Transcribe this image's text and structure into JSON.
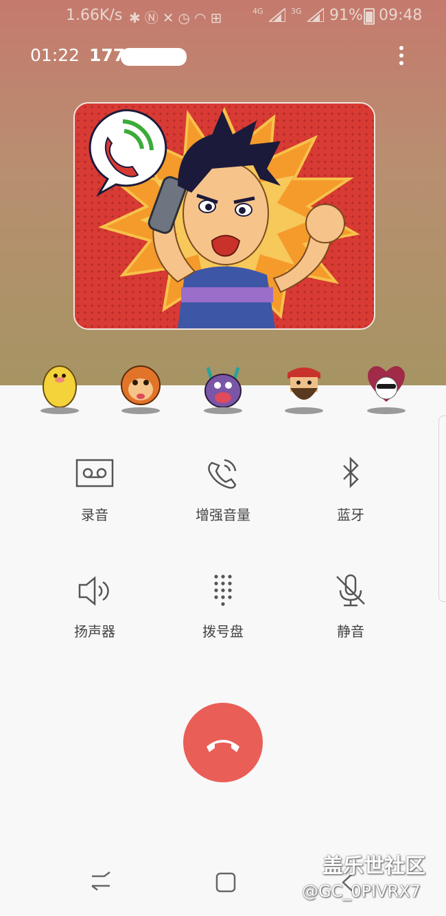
{
  "status_bar": {
    "net_speed": "1.66K/s",
    "icons": [
      "bluetooth-icon",
      "nfc-icon",
      "mute-icon",
      "alarm-icon",
      "wifi-icon",
      "hotspot-icon"
    ],
    "signal1_label": "4G",
    "signal2_label": "3G",
    "battery": "91%",
    "time": "09:48"
  },
  "call": {
    "duration": "01:22",
    "number": "177        68"
  },
  "emoji_stickers": [
    "potato-sticker",
    "monkey-sticker",
    "monster-sticker",
    "bearded-man-sticker",
    "heart-sticker"
  ],
  "controls": [
    {
      "id": "record",
      "label": "录音",
      "icon": "voicemail-icon"
    },
    {
      "id": "boost",
      "label": "增强音量",
      "icon": "phone-waves-icon"
    },
    {
      "id": "bluetooth",
      "label": "蓝牙",
      "icon": "bluetooth-icon"
    },
    {
      "id": "speaker",
      "label": "扬声器",
      "icon": "speaker-icon"
    },
    {
      "id": "keypad",
      "label": "拨号盘",
      "icon": "dialpad-icon"
    },
    {
      "id": "mute",
      "label": "静音",
      "icon": "mic-off-icon"
    }
  ],
  "colors": {
    "end_call": "#e95e56",
    "header_top": "#c57a6e",
    "header_bottom": "#a69463"
  },
  "watermark": {
    "line1": "盖乐世社区",
    "line2": "@GC_0PIVRX7"
  }
}
